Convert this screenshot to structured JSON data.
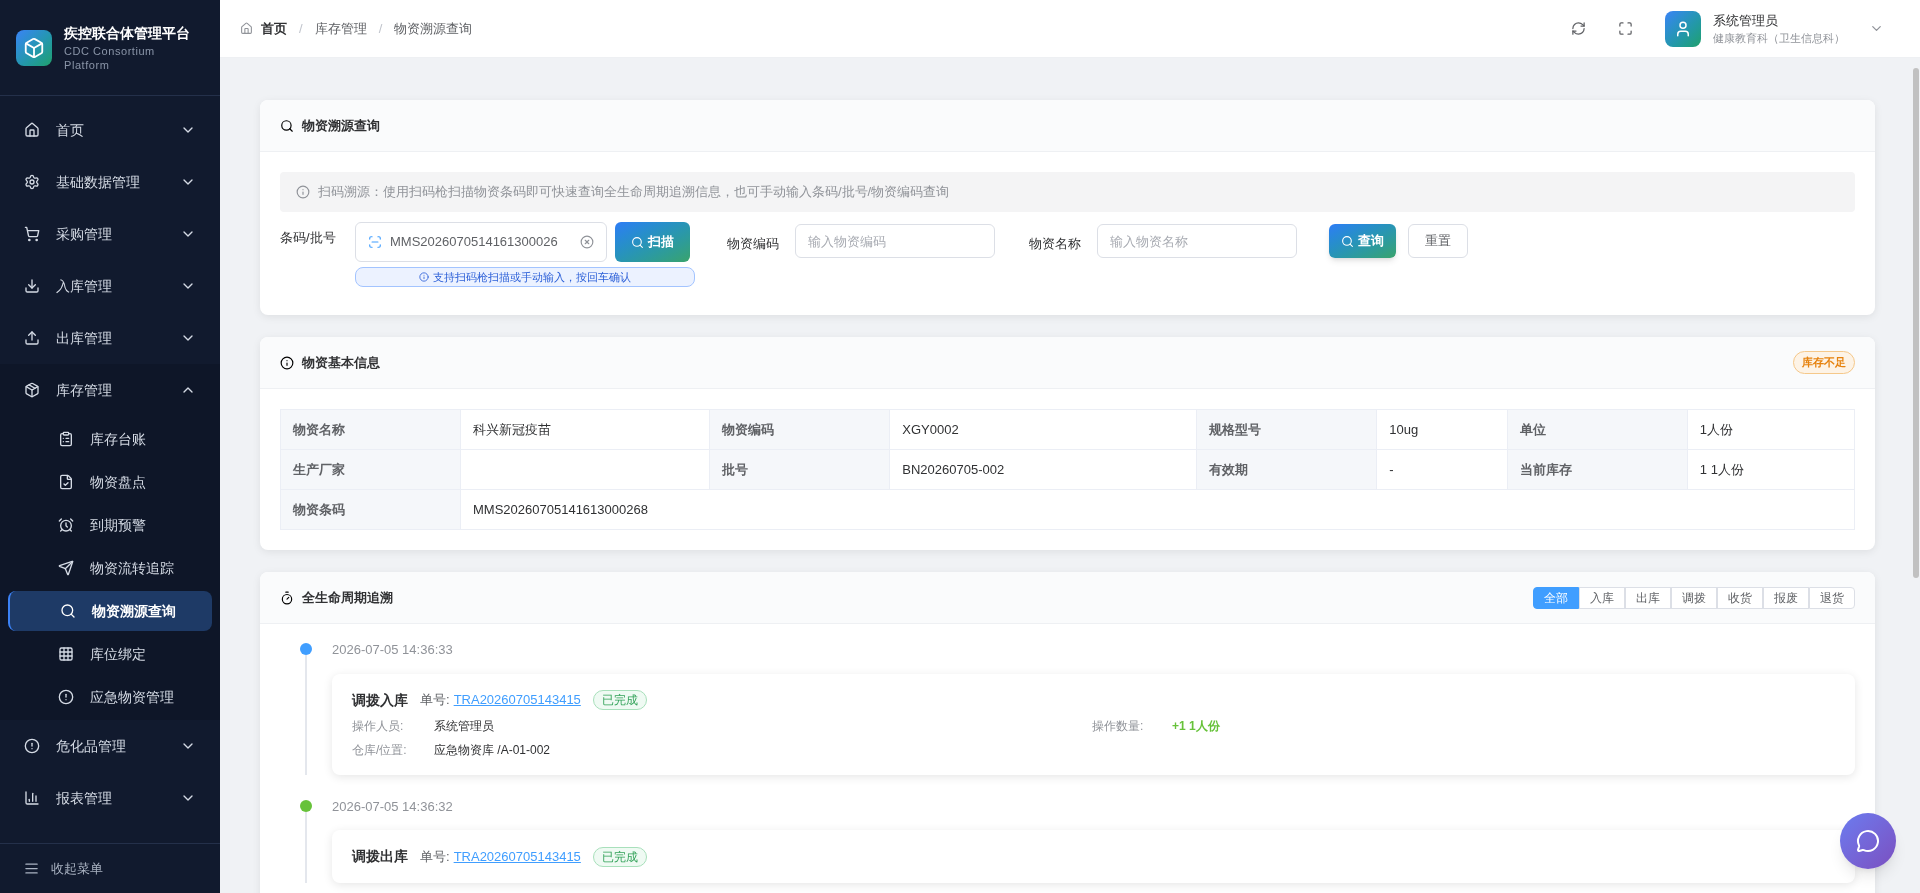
{
  "brand": {
    "title": "疾控联合体管理平台",
    "subtitle": "CDC Consortium Platform"
  },
  "sidebar": {
    "items": [
      {
        "label": "首页",
        "expanded": false
      },
      {
        "label": "基础数据管理",
        "expanded": false
      },
      {
        "label": "采购管理",
        "expanded": false
      },
      {
        "label": "入库管理",
        "expanded": false
      },
      {
        "label": "出库管理",
        "expanded": false
      },
      {
        "label": "库存管理",
        "expanded": true,
        "children": [
          {
            "label": "库存台账",
            "selected": false
          },
          {
            "label": "物资盘点",
            "selected": false
          },
          {
            "label": "到期预警",
            "selected": false
          },
          {
            "label": "物资流转追踪",
            "selected": false
          },
          {
            "label": "物资溯源查询",
            "selected": true
          },
          {
            "label": "库位绑定",
            "selected": false
          },
          {
            "label": "应急物资管理",
            "selected": false
          }
        ]
      },
      {
        "label": "危化品管理",
        "expanded": false
      },
      {
        "label": "报表管理",
        "expanded": false
      }
    ],
    "collapse": "收起菜单"
  },
  "breadcrumb": [
    "首页",
    "库存管理",
    "物资溯源查询"
  ],
  "breadcrumb_separator": "/",
  "user": {
    "name": "系统管理员",
    "dept": "健康教育科（卫生信息科）"
  },
  "search_card": {
    "title": "物资溯源查询",
    "tip": "扫码溯源：使用扫码枪扫描物资条码即可快速查询全生命周期追溯信息，也可手动输入条码/批号/物资编码查询",
    "barcode_label": "条码/批号",
    "barcode_value": "MMS2026070514161300026",
    "scan_button": "扫描",
    "hint": "支持扫码枪扫描或手动输入，按回车确认",
    "code_label": "物资编码",
    "code_placeholder": "输入物资编码",
    "name_label": "物资名称",
    "name_placeholder": "输入物资名称",
    "query_button": "查询",
    "reset_button": "重置"
  },
  "info_card": {
    "title": "物资基本信息",
    "badge": "库存不足",
    "rows": [
      [
        {
          "label": "物资名称",
          "value": "科兴新冠疫苗"
        },
        {
          "label": "物资编码",
          "value": "XGY0002"
        },
        {
          "label": "规格型号",
          "value": "10ug"
        },
        {
          "label": "单位",
          "value": "1人份"
        }
      ],
      [
        {
          "label": "生产厂家"
        },
        {
          "label": "批号",
          "value": "BN20260705-002"
        },
        {
          "label": "有效期",
          "value": "-"
        },
        {
          "label": "当前库存",
          "value": "1 1人份"
        }
      ],
      [
        {
          "label": "物资条码",
          "value": "MMS20260705141613000268"
        }
      ]
    ]
  },
  "timeline_card": {
    "title": "全生命周期追溯",
    "filters": [
      {
        "label": "全部",
        "selected": true
      },
      {
        "label": "入库",
        "selected": false
      },
      {
        "label": "出库",
        "selected": false
      },
      {
        "label": "调拨",
        "selected": false
      },
      {
        "label": "收货",
        "selected": false
      },
      {
        "label": "报废",
        "selected": false
      },
      {
        "label": "退货",
        "selected": false
      }
    ],
    "entries": [
      {
        "time": "2026-07-05 14:36:33",
        "color": "#409eff",
        "type": "调拨入库",
        "order_label": "单号:",
        "order": "TRA20260705143415",
        "status": "已完成",
        "operator_label": "操作人员:",
        "operator": "系统管理员",
        "qty_label": "操作数量:",
        "qty": "+1 1人份",
        "location_label": "仓库/位置:",
        "location": "应急物资库 /A-01-002"
      },
      {
        "time": "2026-07-05 14:36:32",
        "color": "#67c23a",
        "type": "调拨出库",
        "order_label": "单号:",
        "order": "TRA20260705143415",
        "status": "已完成"
      }
    ]
  }
}
